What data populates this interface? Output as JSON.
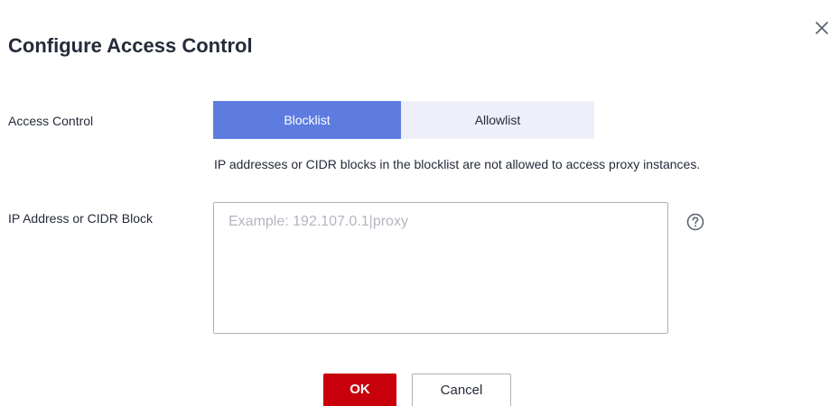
{
  "dialog": {
    "title": "Configure Access Control",
    "close_icon": "close-icon"
  },
  "access_control": {
    "label": "Access Control",
    "options": [
      "Blocklist",
      "Allowlist"
    ],
    "selected": "Blocklist",
    "hint": "IP addresses or CIDR blocks in the blocklist are not allowed to access proxy instances."
  },
  "ip_field": {
    "label": "IP Address or CIDR Block",
    "value": "",
    "placeholder": "Example: 192.107.0.1|proxy",
    "help_icon": "question-circle-icon"
  },
  "footer": {
    "ok_label": "OK",
    "cancel_label": "Cancel"
  },
  "colors": {
    "accent": "#5e7ce0",
    "segment_inactive": "#edf0fb",
    "primary_button": "#c7000b",
    "text": "#252b3a",
    "placeholder": "#b3b6bf"
  }
}
